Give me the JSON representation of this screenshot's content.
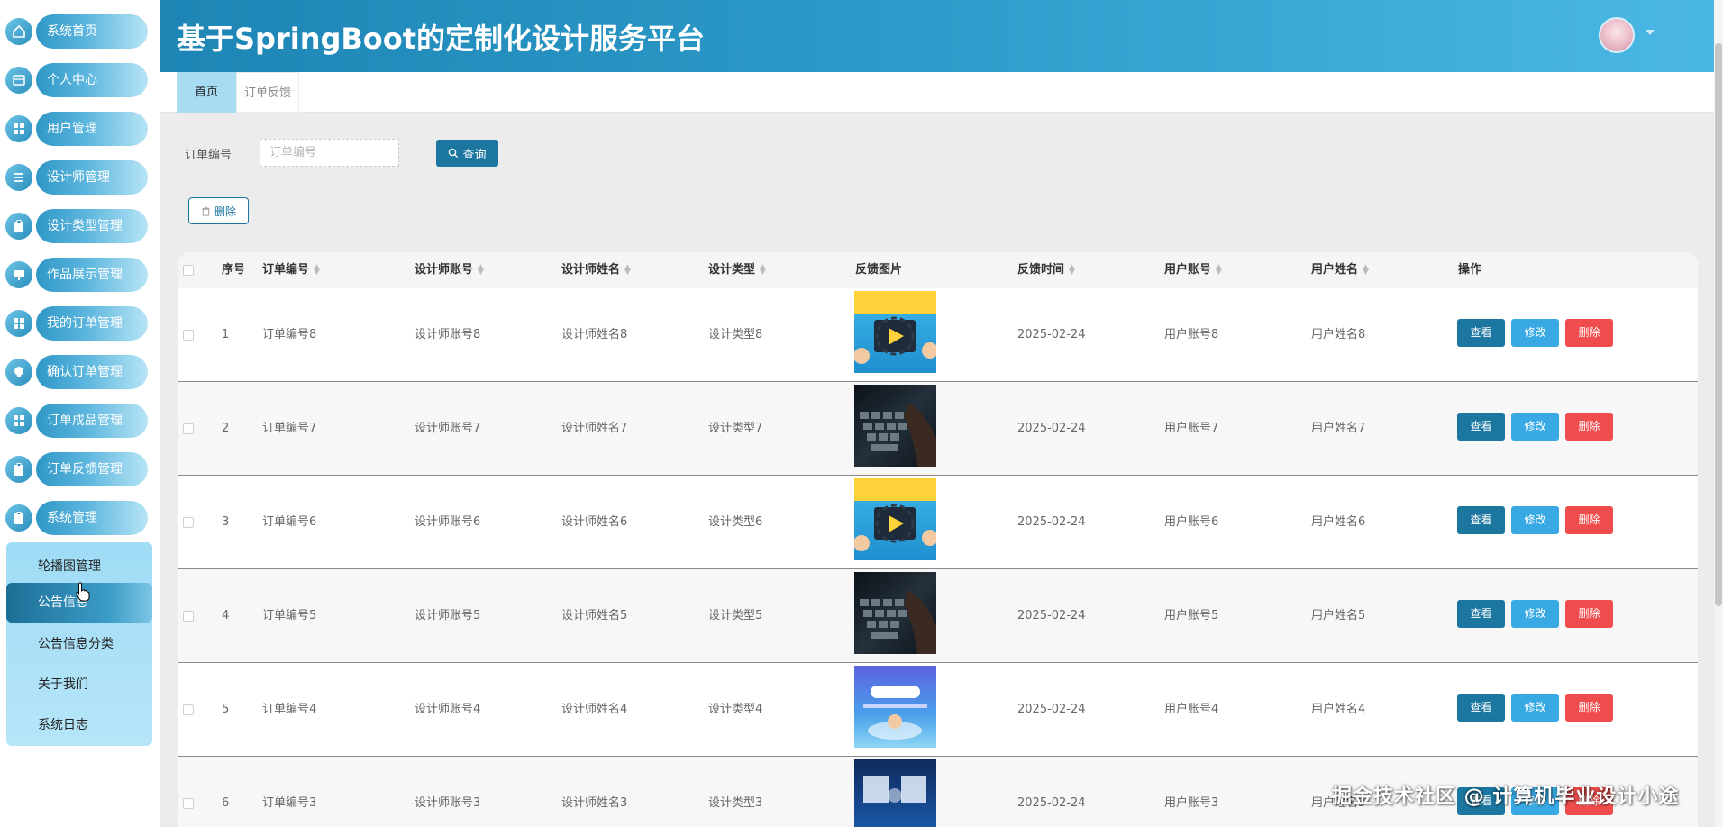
{
  "header": {
    "title": "基于SpringBoot的定制化设计服务平台"
  },
  "sidebar": {
    "items": [
      {
        "label": "系统首页",
        "icon": "home-icon"
      },
      {
        "label": "个人中心",
        "icon": "person-card-icon"
      },
      {
        "label": "用户管理",
        "icon": "grid-icon"
      },
      {
        "label": "设计师管理",
        "icon": "list-icon"
      },
      {
        "label": "设计类型管理",
        "icon": "clipboard-icon"
      },
      {
        "label": "作品展示管理",
        "icon": "monitor-icon"
      },
      {
        "label": "我的订单管理",
        "icon": "grid-icon"
      },
      {
        "label": "确认订单管理",
        "icon": "bulb-icon"
      },
      {
        "label": "订单成品管理",
        "icon": "grid-icon"
      },
      {
        "label": "订单反馈管理",
        "icon": "clipboard-icon"
      },
      {
        "label": "系统管理",
        "icon": "clipboard-icon"
      }
    ],
    "submenu": [
      {
        "label": "轮播图管理"
      },
      {
        "label": "公告信息"
      },
      {
        "label": "公告信息分类"
      },
      {
        "label": "关于我们"
      },
      {
        "label": "系统日志"
      }
    ]
  },
  "tabs": [
    {
      "label": "首页"
    },
    {
      "label": "订单反馈"
    }
  ],
  "search": {
    "label": "订单编号",
    "placeholder": "订单编号",
    "value": "",
    "button": "查询"
  },
  "toolbar": {
    "delete_label": "删除"
  },
  "table": {
    "columns": [
      "序号",
      "订单编号",
      "设计师账号",
      "设计师姓名",
      "设计类型",
      "反馈图片",
      "反馈时间",
      "用户账号",
      "用户姓名",
      "操作"
    ],
    "rows": [
      {
        "index": "1",
        "order_no": "订单编号8",
        "designer_account": "设计师账号8",
        "designer_name": "设计师姓名8",
        "design_type": "设计类型8",
        "image": "cartoon",
        "time": "2025-02-24",
        "user_account": "用户账号8",
        "user_name": "用户姓名8"
      },
      {
        "index": "2",
        "order_no": "订单编号7",
        "designer_account": "设计师账号7",
        "designer_name": "设计师姓名7",
        "design_type": "设计类型7",
        "image": "keyboard",
        "time": "2025-02-24",
        "user_account": "用户账号7",
        "user_name": "用户姓名7"
      },
      {
        "index": "3",
        "order_no": "订单编号6",
        "designer_account": "设计师账号6",
        "designer_name": "设计师姓名6",
        "design_type": "设计类型6",
        "image": "cartoon",
        "time": "2025-02-24",
        "user_account": "用户账号6",
        "user_name": "用户姓名6"
      },
      {
        "index": "4",
        "order_no": "订单编号5",
        "designer_account": "设计师账号5",
        "designer_name": "设计师姓名5",
        "design_type": "设计类型5",
        "image": "keyboard",
        "time": "2025-02-24",
        "user_account": "用户账号5",
        "user_name": "用户姓名5"
      },
      {
        "index": "5",
        "order_no": "订单编号4",
        "designer_account": "设计师账号4",
        "designer_name": "设计师姓名4",
        "design_type": "设计类型4",
        "image": "coding",
        "time": "2025-02-24",
        "user_account": "用户账号4",
        "user_name": "用户姓名4"
      },
      {
        "index": "6",
        "order_no": "订单编号3",
        "designer_account": "设计师账号3",
        "designer_name": "设计师姓名3",
        "design_type": "设计类型3",
        "image": "bianc",
        "time": "2025-02-24",
        "user_account": "用户账号3",
        "user_name": "用户姓名3"
      }
    ],
    "actions": {
      "view": "查看",
      "edit": "修改",
      "delete": "删除"
    }
  },
  "watermark": "掘金技术社区 @ 计算机毕业设计小途",
  "colors": {
    "primary": "#1b76a0",
    "edit": "#38a9e3",
    "danger": "#ef4d4d",
    "header_start": "#1e85b5",
    "header_end": "#4bb8e4"
  }
}
